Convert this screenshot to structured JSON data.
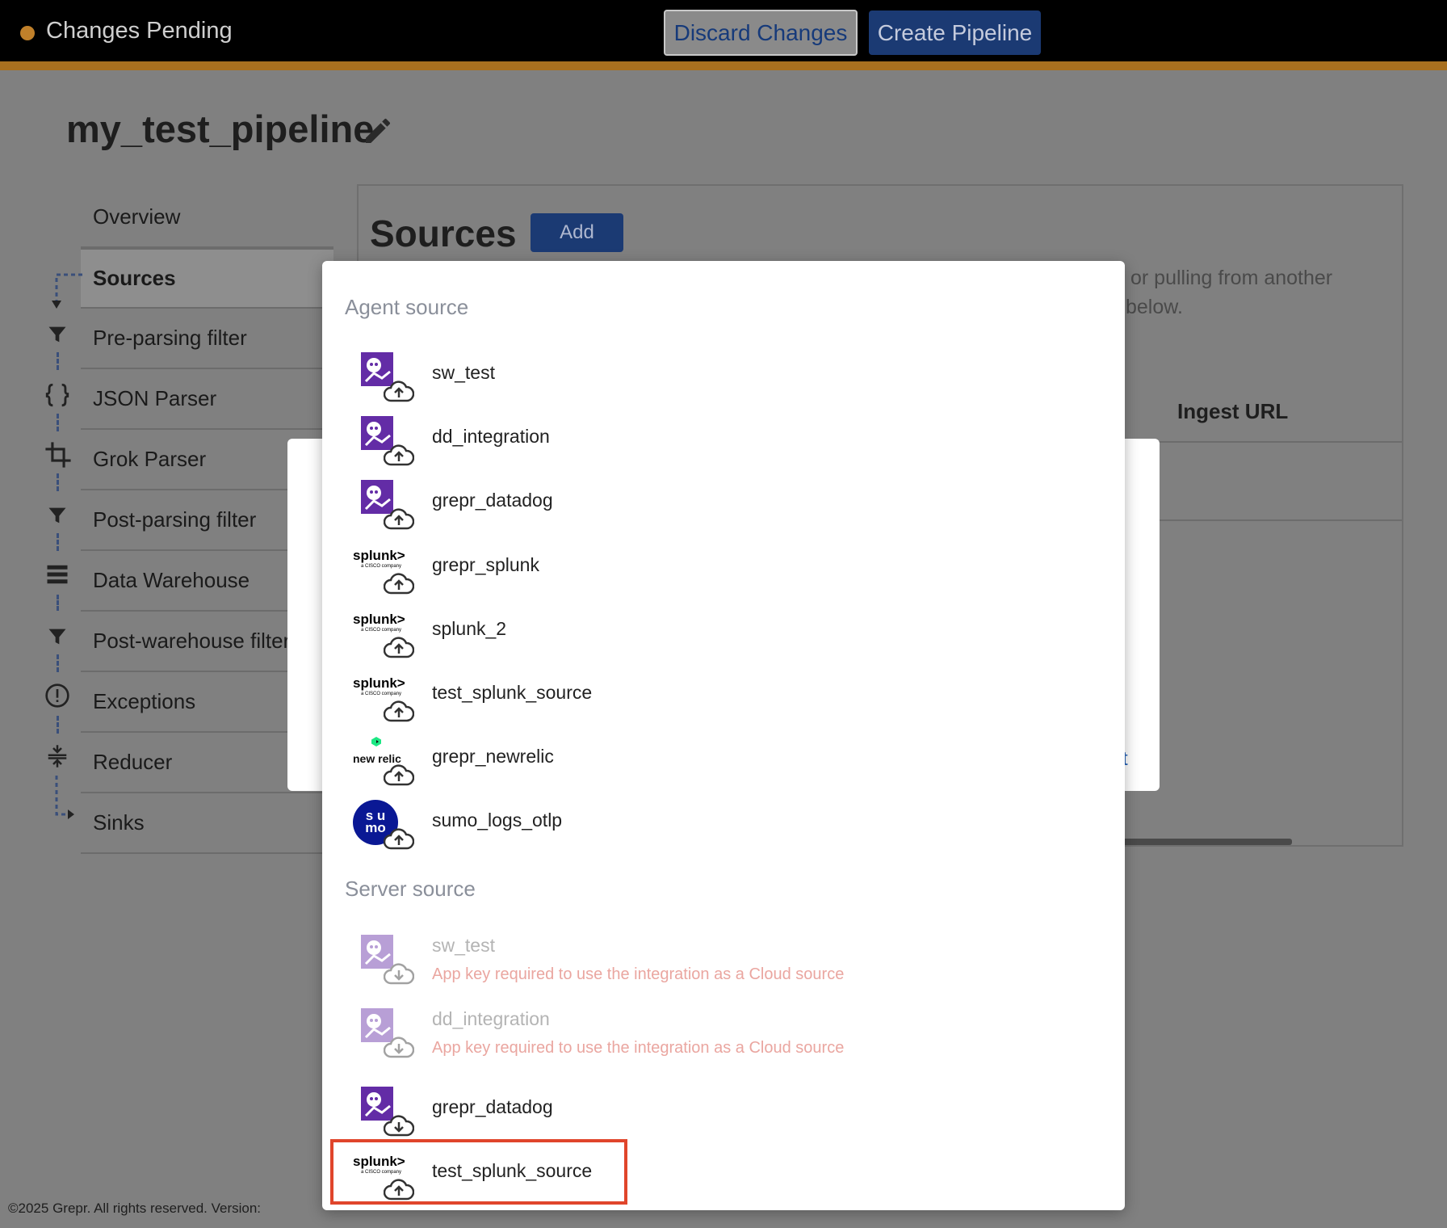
{
  "topbar": {
    "status_text": "Changes Pending",
    "discard_label": "Discard Changes",
    "create_label": "Create Pipeline"
  },
  "pipeline": {
    "title": "my_test_pipeline"
  },
  "sidebar": {
    "items": [
      {
        "label": "Overview",
        "icon": "none"
      },
      {
        "label": "Sources",
        "icon": "dashed-arrow-icon"
      },
      {
        "label": "Pre-parsing filter",
        "icon": "filter-icon"
      },
      {
        "label": "JSON Parser",
        "icon": "braces-icon"
      },
      {
        "label": "Grok Parser",
        "icon": "crop-icon"
      },
      {
        "label": "Post-parsing filter",
        "icon": "filter-icon"
      },
      {
        "label": "Data Warehouse",
        "icon": "storage-icon"
      },
      {
        "label": "Post-warehouse filter",
        "icon": "filter-icon"
      },
      {
        "label": "Exceptions",
        "icon": "alert-circle-icon"
      },
      {
        "label": "Reducer",
        "icon": "compress-icon"
      },
      {
        "label": "Sinks",
        "icon": "arrow-right-icon"
      }
    ]
  },
  "main": {
    "title": "Sources",
    "add_label": "Add",
    "desc_line1": "or pulling from another",
    "desc_line2": "below.",
    "ingest_header": "Ingest URL",
    "dialog_link": "t"
  },
  "menu": {
    "agent_label": "Agent source",
    "server_label": "Server source",
    "agent_items": [
      {
        "name": "sw_test",
        "logo": "datadog"
      },
      {
        "name": "dd_integration",
        "logo": "datadog"
      },
      {
        "name": "grepr_datadog",
        "logo": "datadog"
      },
      {
        "name": "grepr_splunk",
        "logo": "splunk"
      },
      {
        "name": "splunk_2",
        "logo": "splunk"
      },
      {
        "name": "test_splunk_source",
        "logo": "splunk"
      },
      {
        "name": "grepr_newrelic",
        "logo": "newrelic"
      },
      {
        "name": "sumo_logs_otlp",
        "logo": "sumo"
      }
    ],
    "server_items": [
      {
        "name": "sw_test",
        "logo": "datadog",
        "error": "App key required to use the integration as a Cloud source"
      },
      {
        "name": "dd_integration",
        "logo": "datadog",
        "error": "App key required to use the integration as a Cloud source"
      },
      {
        "name": "grepr_datadog",
        "logo": "datadog"
      },
      {
        "name": "test_splunk_source",
        "logo": "splunk"
      }
    ],
    "logo_text": {
      "splunk": "splunk>",
      "splunk_sub": "a CISCO company",
      "newrelic": "new relic",
      "sumo_top": "s u",
      "sumo_bottom": "mo"
    }
  },
  "footer": {
    "text": "©2025 Grepr. All rights reserved.   Version:"
  },
  "colors": {
    "accent": "#1b3a73",
    "status_dot": "#c0802a",
    "highlight": "#e0452b",
    "error": "#eaa6a0"
  }
}
